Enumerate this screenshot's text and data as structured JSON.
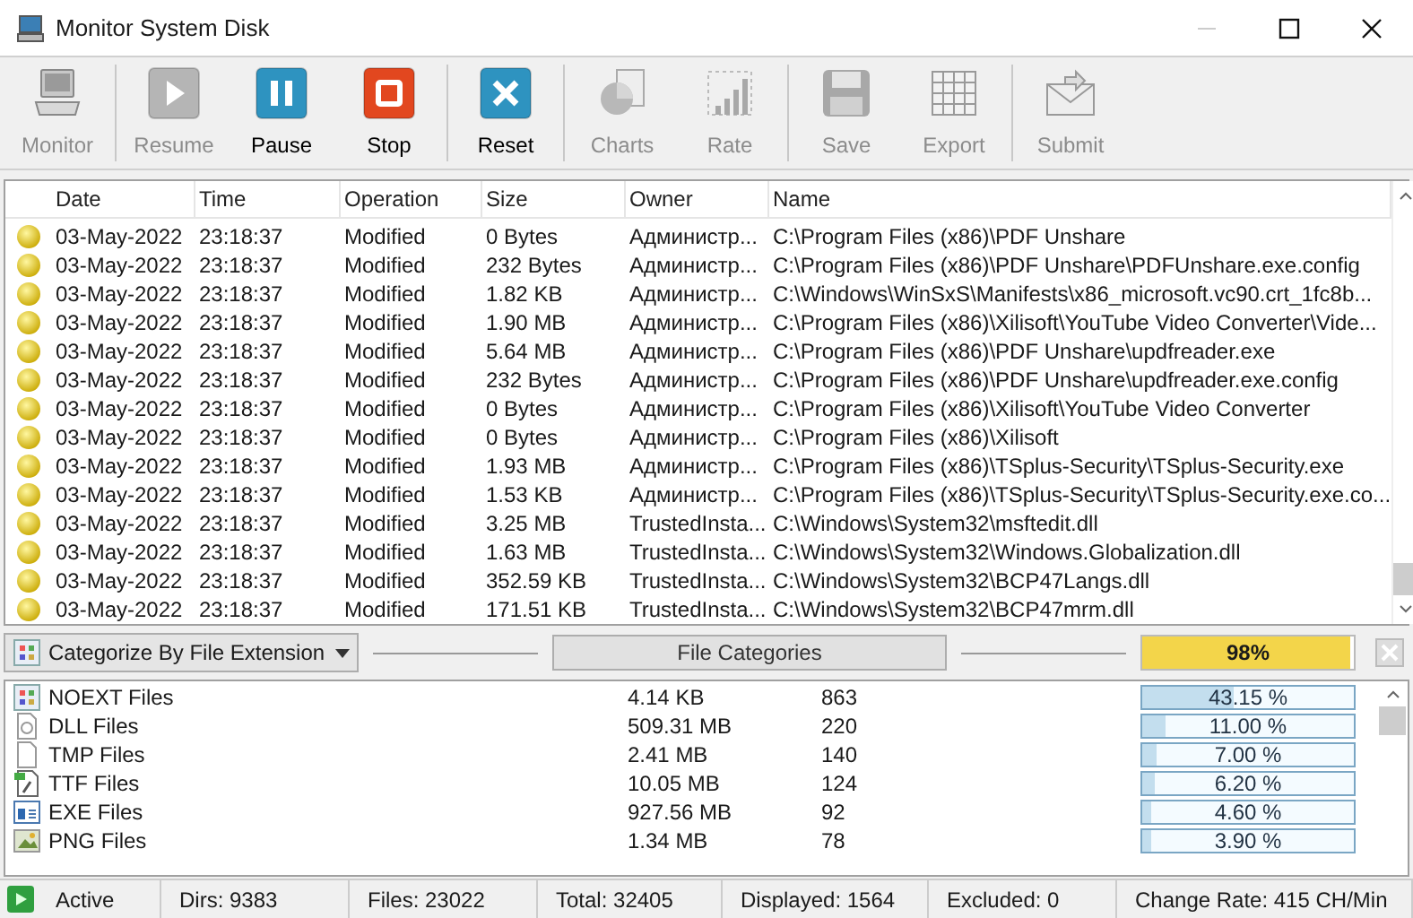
{
  "window": {
    "title": "Monitor System Disk"
  },
  "toolbar": {
    "groups": [
      [
        {
          "kind": "monitor",
          "label": "Monitor",
          "disabled": true
        }
      ],
      [
        {
          "kind": "resume",
          "label": "Resume",
          "disabled": true
        },
        {
          "kind": "pause",
          "label": "Pause",
          "disabled": false
        },
        {
          "kind": "stop",
          "label": "Stop",
          "disabled": false
        }
      ],
      [
        {
          "kind": "reset",
          "label": "Reset",
          "disabled": false
        }
      ],
      [
        {
          "kind": "charts",
          "label": "Charts",
          "disabled": true
        },
        {
          "kind": "rate",
          "label": "Rate",
          "disabled": true
        }
      ],
      [
        {
          "kind": "save",
          "label": "Save",
          "disabled": true
        },
        {
          "kind": "export",
          "label": "Export",
          "disabled": true
        }
      ],
      [
        {
          "kind": "submit",
          "label": "Submit",
          "disabled": true
        }
      ]
    ]
  },
  "table": {
    "columns": [
      "Date",
      "Time",
      "Operation",
      "Size",
      "Owner",
      "Name"
    ],
    "rows": [
      {
        "cells": [
          "03-May-2022",
          "23:18:37",
          "Modified",
          "0 Bytes",
          "Администр...",
          "C:\\Program Files (x86)\\PDF Unshare"
        ]
      },
      {
        "cells": [
          "03-May-2022",
          "23:18:37",
          "Modified",
          "232 Bytes",
          "Администр...",
          "C:\\Program Files (x86)\\PDF Unshare\\PDFUnshare.exe.config"
        ]
      },
      {
        "cells": [
          "03-May-2022",
          "23:18:37",
          "Modified",
          "1.82 KB",
          "Администр...",
          "C:\\Windows\\WinSxS\\Manifests\\x86_microsoft.vc90.crt_1fc8b..."
        ]
      },
      {
        "cells": [
          "03-May-2022",
          "23:18:37",
          "Modified",
          "1.90 MB",
          "Администр...",
          "C:\\Program Files (x86)\\Xilisoft\\YouTube Video Converter\\Vide..."
        ]
      },
      {
        "cells": [
          "03-May-2022",
          "23:18:37",
          "Modified",
          "5.64 MB",
          "Администр...",
          "C:\\Program Files (x86)\\PDF Unshare\\updfreader.exe"
        ]
      },
      {
        "cells": [
          "03-May-2022",
          "23:18:37",
          "Modified",
          "232 Bytes",
          "Администр...",
          "C:\\Program Files (x86)\\PDF Unshare\\updfreader.exe.config"
        ]
      },
      {
        "cells": [
          "03-May-2022",
          "23:18:37",
          "Modified",
          "0 Bytes",
          "Администр...",
          "C:\\Program Files (x86)\\Xilisoft\\YouTube Video Converter"
        ]
      },
      {
        "cells": [
          "03-May-2022",
          "23:18:37",
          "Modified",
          "0 Bytes",
          "Администр...",
          "C:\\Program Files (x86)\\Xilisoft"
        ]
      },
      {
        "cells": [
          "03-May-2022",
          "23:18:37",
          "Modified",
          "1.93 MB",
          "Администр...",
          "C:\\Program Files (x86)\\TSplus-Security\\TSplus-Security.exe"
        ]
      },
      {
        "cells": [
          "03-May-2022",
          "23:18:37",
          "Modified",
          "1.53 KB",
          "Администр...",
          "C:\\Program Files (x86)\\TSplus-Security\\TSplus-Security.exe.co..."
        ]
      },
      {
        "cells": [
          "03-May-2022",
          "23:18:37",
          "Modified",
          "3.25 MB",
          "TrustedInsta...",
          "C:\\Windows\\System32\\msftedit.dll"
        ]
      },
      {
        "cells": [
          "03-May-2022",
          "23:18:37",
          "Modified",
          "1.63 MB",
          "TrustedInsta...",
          "C:\\Windows\\System32\\Windows.Globalization.dll"
        ]
      },
      {
        "cells": [
          "03-May-2022",
          "23:18:37",
          "Modified",
          "352.59 KB",
          "TrustedInsta...",
          "C:\\Windows\\System32\\BCP47Langs.dll"
        ]
      },
      {
        "cells": [
          "03-May-2022",
          "23:18:37",
          "Modified",
          "171.51 KB",
          "TrustedInsta...",
          "C:\\Windows\\System32\\BCP47mrm.dll"
        ]
      }
    ]
  },
  "categories": {
    "select": "Categorize By File Extension",
    "button": "File Categories",
    "progress": {
      "level": 0.98,
      "reading": "98%"
    },
    "rows": [
      {
        "kind": "noext",
        "name": "NOEXT Files",
        "size": "4.14 KB",
        "count": "863",
        "percent": "43.15 %",
        "level": 0.4315
      },
      {
        "kind": "dll",
        "name": "DLL Files",
        "size": "509.31 MB",
        "count": "220",
        "percent": "11.00 %",
        "level": 0.11
      },
      {
        "kind": "tmp",
        "name": "TMP Files",
        "size": "2.41 MB",
        "count": "140",
        "percent": "7.00 %",
        "level": 0.07
      },
      {
        "kind": "ttf",
        "name": "TTF Files",
        "size": "10.05 MB",
        "count": "124",
        "percent": "6.20 %",
        "level": 0.062
      },
      {
        "kind": "exe",
        "name": "EXE Files",
        "size": "927.56 MB",
        "count": "92",
        "percent": "4.60 %",
        "level": 0.046
      },
      {
        "kind": "png",
        "name": "PNG Files",
        "size": "1.34 MB",
        "count": "78",
        "percent": "3.90 %",
        "level": 0.039
      }
    ]
  },
  "status_bar": {
    "state": "Active",
    "fields": [
      "Dirs: 9383",
      "Files: 23022",
      "Total: 32405",
      "Displayed: 1564",
      "Excluded: 0",
      "Change Rate: 415 CH/Min"
    ]
  }
}
